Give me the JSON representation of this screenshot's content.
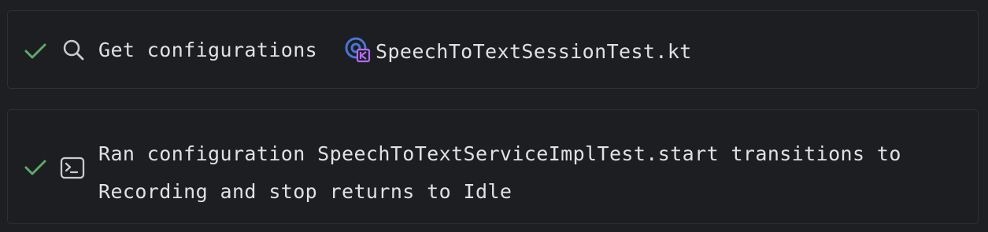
{
  "steps": [
    {
      "status": "done",
      "icon": "search-icon",
      "action": "Get configurations",
      "file_icon": "kotlin-test-file-icon",
      "file": "SpeechToTextSessionTest.kt"
    },
    {
      "status": "done",
      "icon": "terminal-icon",
      "line1": "Ran configuration SpeechToTextServiceImplTest.start transitions to",
      "line2": "Recording and stop returns to Idle"
    }
  ],
  "colors": {
    "success": "#5fa86b",
    "icon": "#c9cbd0",
    "text": "#dfe1e5",
    "kotlin_blue": "#4b73d6",
    "kotlin_purple": "#b36bff"
  }
}
